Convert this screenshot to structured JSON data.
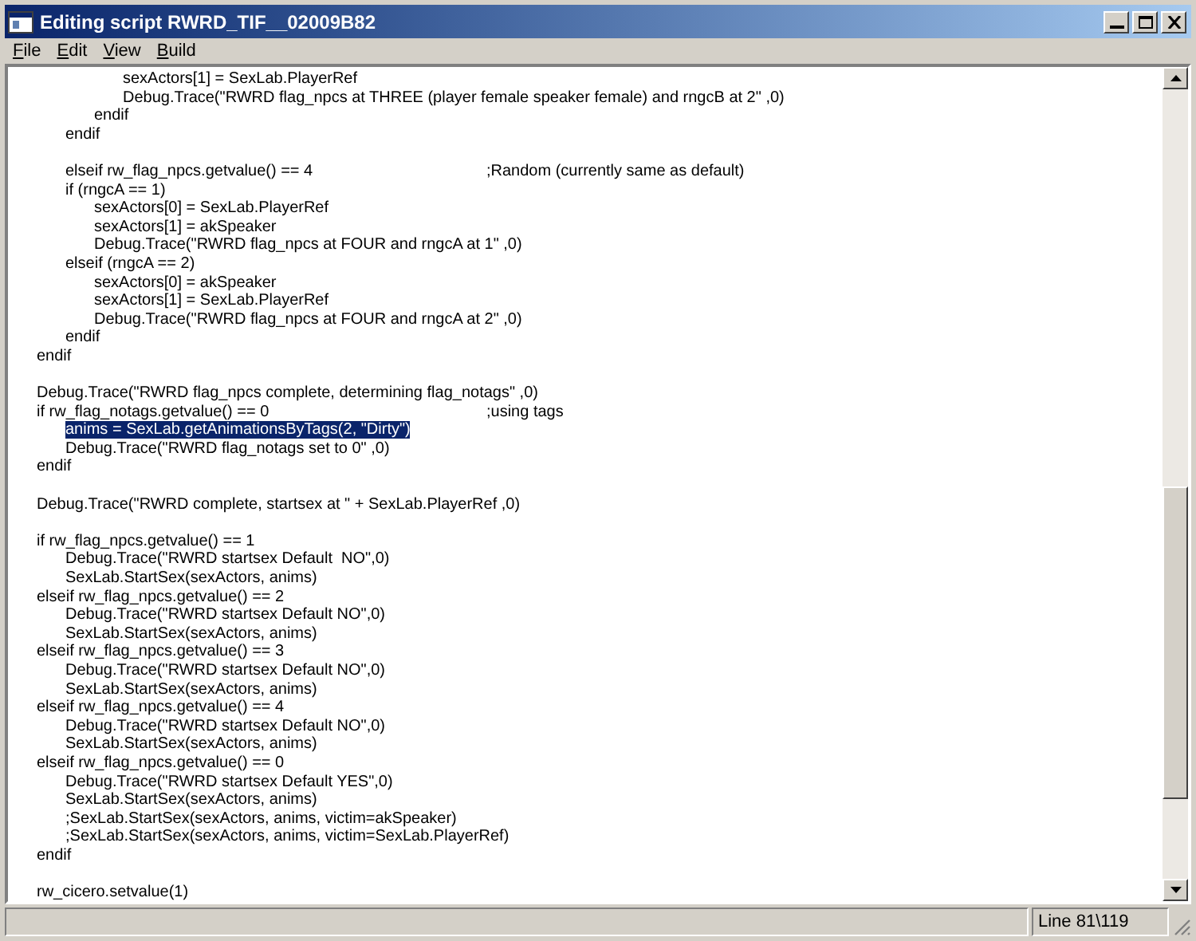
{
  "window": {
    "title": "Editing script RWRD_TIF__02009B82"
  },
  "menu": [
    {
      "label": "File"
    },
    {
      "label": "Edit"
    },
    {
      "label": "View"
    },
    {
      "label": "Build"
    }
  ],
  "editor": {
    "lines": [
      {
        "text": "\t\t\tsexActors[1] = SexLab.PlayerRef",
        "selected": false
      },
      {
        "text": "\t\t\tDebug.Trace(\"RWRD flag_npcs at THREE (player female speaker female) and rngcB at 2\" ,0)",
        "selected": false
      },
      {
        "text": "\t\tendif",
        "selected": false
      },
      {
        "text": "\tendif",
        "selected": false
      },
      {
        "selected": false
      },
      {
        "text": "\telseif rw_flag_npcs.getvalue() == 4",
        "comment": ";Random (currently same as default)",
        "selected": false
      },
      {
        "text": "\tif (rngcA == 1)",
        "selected": false
      },
      {
        "text": "\t\tsexActors[0] = SexLab.PlayerRef",
        "selected": false
      },
      {
        "text": "\t\tsexActors[1] = akSpeaker",
        "selected": false
      },
      {
        "text": "\t\tDebug.Trace(\"RWRD flag_npcs at FOUR and rngcA at 1\" ,0)",
        "selected": false
      },
      {
        "text": "\telseif (rngcA == 2)",
        "selected": false
      },
      {
        "text": "\t\tsexActors[0] = akSpeaker",
        "selected": false
      },
      {
        "text": "\t\tsexActors[1] = SexLab.PlayerRef",
        "selected": false
      },
      {
        "text": "\t\tDebug.Trace(\"RWRD flag_npcs at FOUR and rngcA at 2\" ,0)",
        "selected": false
      },
      {
        "text": "\tendif",
        "selected": false
      },
      {
        "text": "endif",
        "selected": false
      },
      {
        "selected": false
      },
      {
        "text": "Debug.Trace(\"RWRD flag_npcs complete, determining flag_notags\" ,0)",
        "selected": false
      },
      {
        "text": "if rw_flag_notags.getvalue() == 0",
        "comment": ";using tags",
        "selected": false
      },
      {
        "text": "\tanims = SexLab.getAnimationsByTags(2, \"Dirty\")",
        "selected": true
      },
      {
        "text": "\tDebug.Trace(\"RWRD flag_notags set to 0\" ,0)",
        "selected": false
      },
      {
        "text": "endif",
        "selected": false
      },
      {
        "selected": false
      },
      {
        "text": "Debug.Trace(\"RWRD complete, startsex at \" + SexLab.PlayerRef ,0)",
        "selected": false
      },
      {
        "selected": false
      },
      {
        "text": "if rw_flag_npcs.getvalue() == 1",
        "selected": false
      },
      {
        "text": "\tDebug.Trace(\"RWRD startsex Default  NO\",0)",
        "selected": false
      },
      {
        "text": "\tSexLab.StartSex(sexActors, anims)",
        "selected": false
      },
      {
        "text": "elseif rw_flag_npcs.getvalue() == 2",
        "selected": false
      },
      {
        "text": "\tDebug.Trace(\"RWRD startsex Default NO\",0)",
        "selected": false
      },
      {
        "text": "\tSexLab.StartSex(sexActors, anims)",
        "selected": false
      },
      {
        "text": "elseif rw_flag_npcs.getvalue() == 3",
        "selected": false
      },
      {
        "text": "\tDebug.Trace(\"RWRD startsex Default NO\",0)",
        "selected": false
      },
      {
        "text": "\tSexLab.StartSex(sexActors, anims)",
        "selected": false
      },
      {
        "text": "elseif rw_flag_npcs.getvalue() == 4",
        "selected": false
      },
      {
        "text": "\tDebug.Trace(\"RWRD startsex Default NO\",0)",
        "selected": false
      },
      {
        "text": "\tSexLab.StartSex(sexActors, anims)",
        "selected": false
      },
      {
        "text": "elseif rw_flag_npcs.getvalue() == 0",
        "selected": false
      },
      {
        "text": "\tDebug.Trace(\"RWRD startsex Default YES\",0)",
        "selected": false
      },
      {
        "text": "\tSexLab.StartSex(sexActors, anims)",
        "selected": false
      },
      {
        "text": "\t;SexLab.StartSex(sexActors, anims, victim=akSpeaker)",
        "selected": false
      },
      {
        "text": "\t;SexLab.StartSex(sexActors, anims, victim=SexLab.PlayerRef)",
        "selected": false
      },
      {
        "text": "endif",
        "selected": false
      },
      {
        "selected": false
      },
      {
        "text": "rw_cicero.setvalue(1)",
        "selected": false
      }
    ]
  },
  "status_bar": {
    "position": "Line 81\\119"
  }
}
